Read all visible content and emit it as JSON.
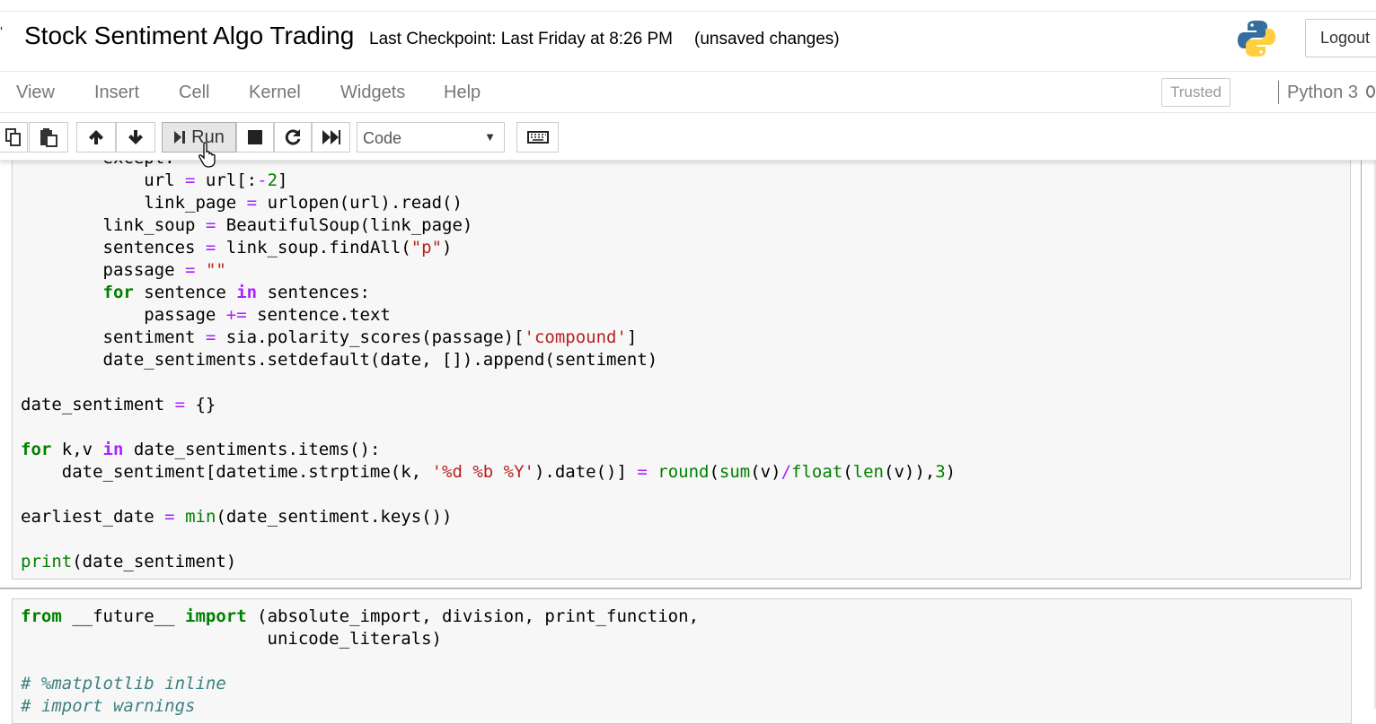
{
  "header": {
    "notebook_name": "Stock Sentiment Algo Trading",
    "checkpoint": "Last Checkpoint: Last Friday at 8:26 PM",
    "unsaved": "(unsaved changes)",
    "logout_label": "Logout",
    "logo_icon": "python-logo-icon"
  },
  "menubar": {
    "items": [
      "View",
      "Insert",
      "Cell",
      "Kernel",
      "Widgets",
      "Help"
    ],
    "trusted": "Trusted",
    "kernel": "Python 3"
  },
  "toolbar": {
    "run_label": "Run",
    "cell_type": "Code",
    "icons": [
      "copy-icon",
      "paste-icon",
      "move-up-icon",
      "move-down-icon",
      "step-run-icon",
      "stop-icon",
      "restart-icon",
      "fast-forward-icon",
      "keyboard-icon"
    ]
  },
  "cells": [
    {
      "lines": [
        "        except:",
        "            url = url[:-2]",
        "            link_page = urlopen(url).read()",
        "        link_soup = BeautifulSoup(link_page)",
        "        sentences = link_soup.findAll(\"p\")",
        "        passage = \"\"",
        "        for sentence in sentences:",
        "            passage += sentence.text",
        "        sentiment = sia.polarity_scores(passage)['compound']",
        "        date_sentiments.setdefault(date, []).append(sentiment)",
        "",
        "date_sentiment = {}",
        "",
        "for k,v in date_sentiments.items():",
        "    date_sentiment[datetime.strptime(k, '%d %b %Y').date()] = round(sum(v)/float(len(v)),3)",
        "",
        "earliest_date = min(date_sentiment.keys())",
        "",
        "print(date_sentiment)"
      ]
    },
    {
      "lines": [
        "from __future__ import (absolute_import, division, print_function,",
        "                        unicode_literals)",
        "",
        "# %matplotlib inline",
        "# import warnings"
      ]
    }
  ]
}
